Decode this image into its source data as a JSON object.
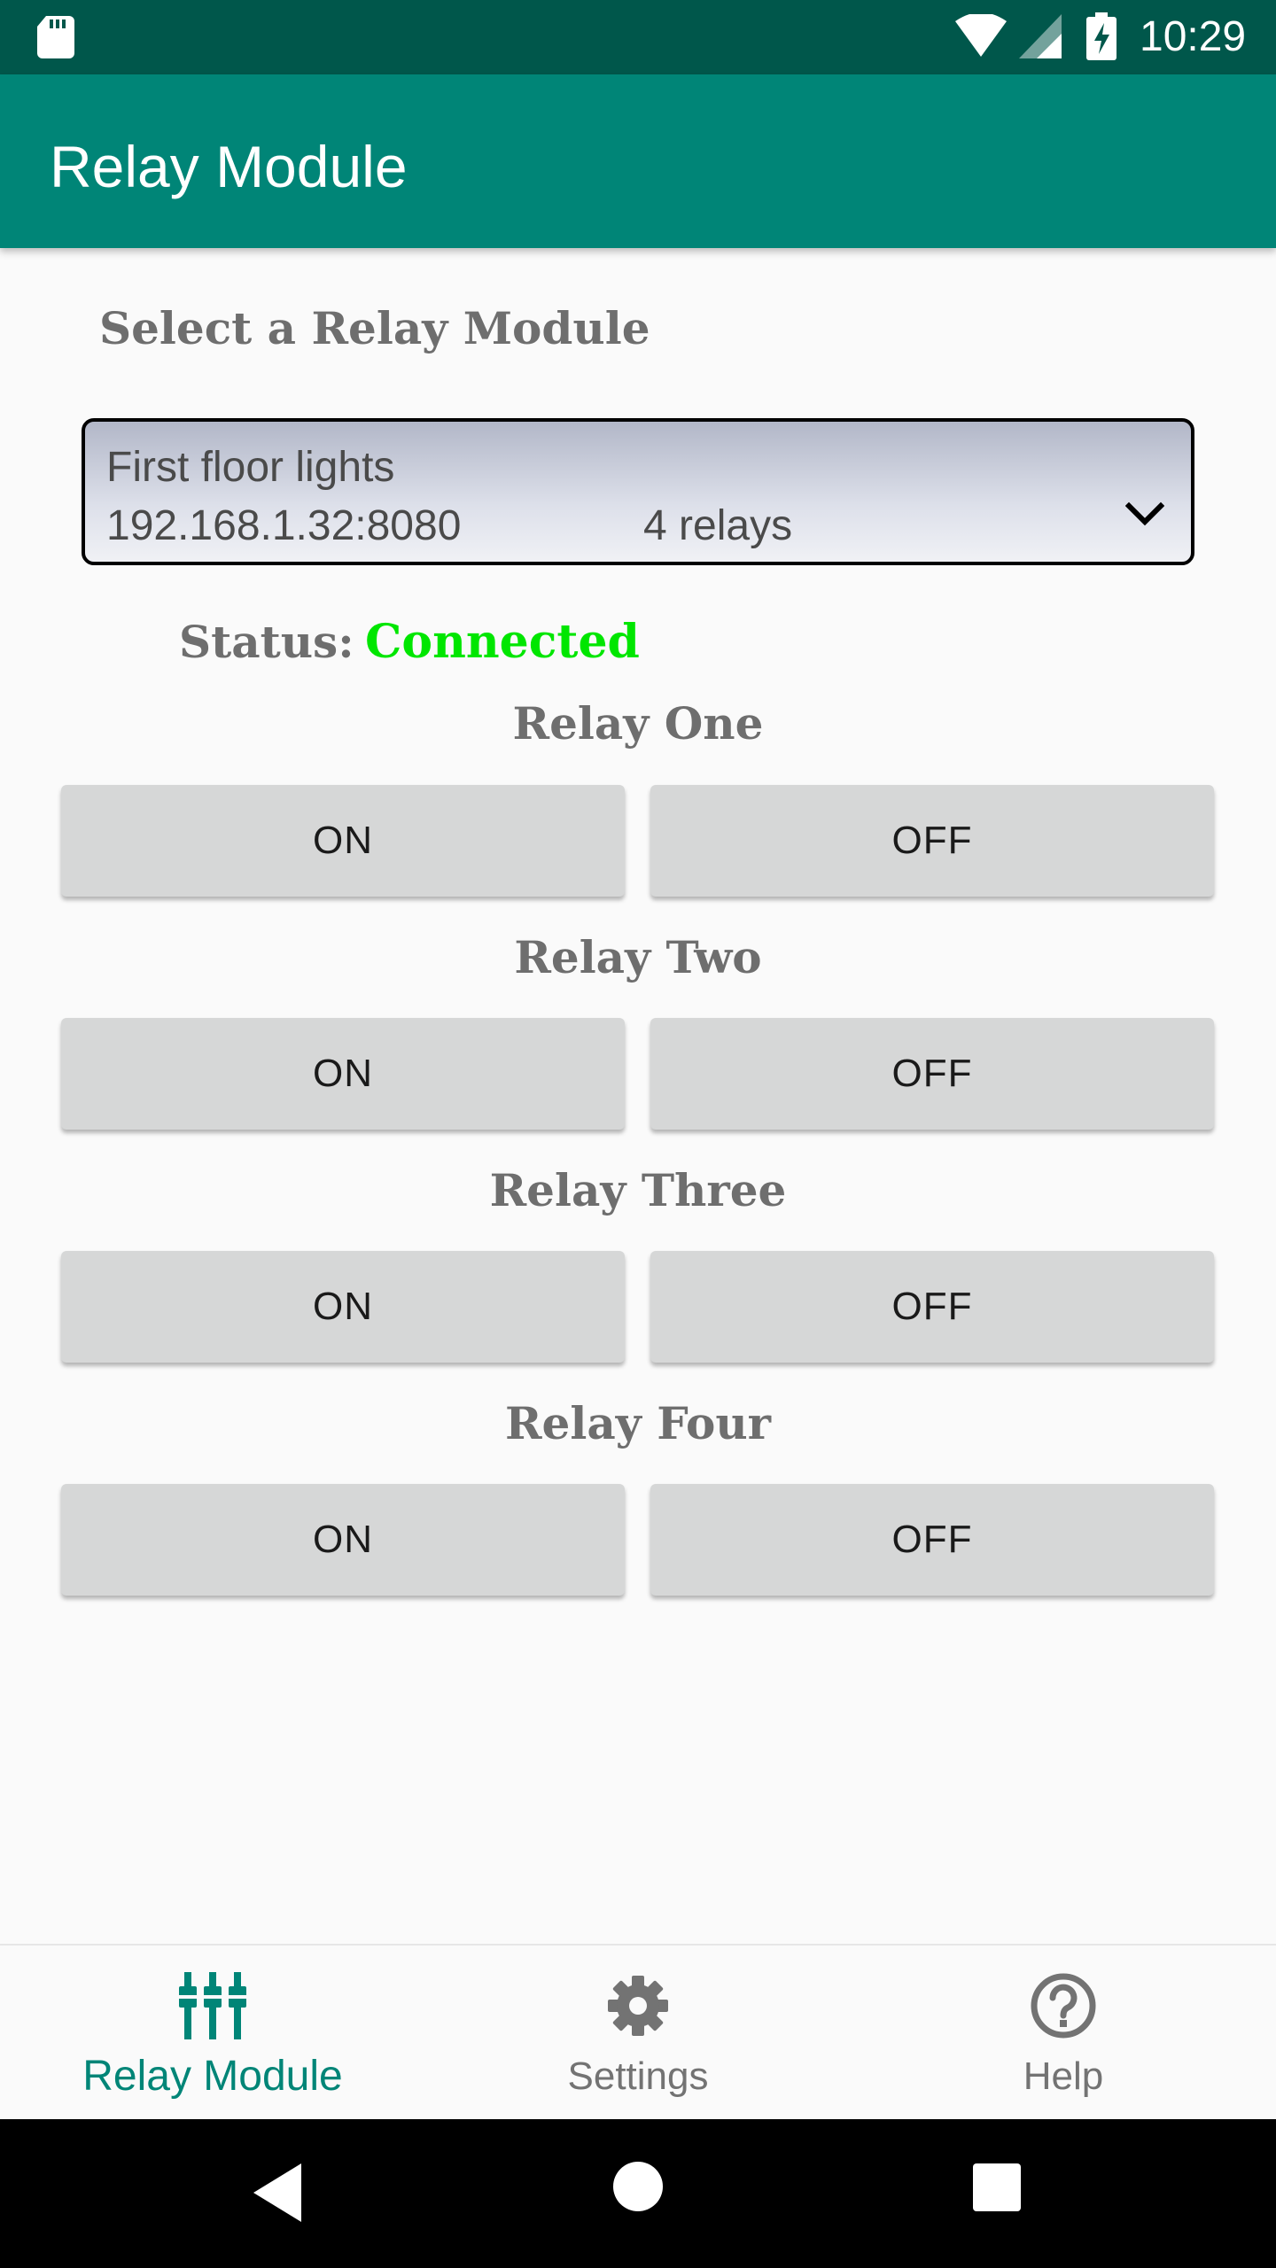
{
  "status_bar": {
    "time": "10:29",
    "icons": [
      "sd-card-icon",
      "wifi-icon",
      "cell-signal-icon",
      "battery-charging-icon"
    ]
  },
  "app_bar": {
    "title": "Relay Module",
    "color": "#008577"
  },
  "selector": {
    "heading": "Select a Relay Module",
    "selected": {
      "name": "First floor lights",
      "address": "192.168.1.32:8080",
      "relays": "4 relays"
    }
  },
  "status": {
    "label": "Status:",
    "value": "Connected",
    "value_color": "#00e600"
  },
  "relays": [
    {
      "title": "Relay One",
      "on_label": "ON",
      "off_label": "OFF"
    },
    {
      "title": "Relay Two",
      "on_label": "ON",
      "off_label": "OFF"
    },
    {
      "title": "Relay Three",
      "on_label": "ON",
      "off_label": "OFF"
    },
    {
      "title": "Relay Four",
      "on_label": "ON",
      "off_label": "OFF"
    }
  ],
  "bottom_nav": {
    "items": [
      {
        "label": "Relay Module",
        "icon": "relay-module-icon",
        "active": true
      },
      {
        "label": "Settings",
        "icon": "gear-icon",
        "active": false
      },
      {
        "label": "Help",
        "icon": "help-icon",
        "active": false
      }
    ],
    "active_color": "#008577"
  },
  "system_nav": {
    "icons": [
      "back-icon",
      "home-icon",
      "recents-icon"
    ]
  }
}
